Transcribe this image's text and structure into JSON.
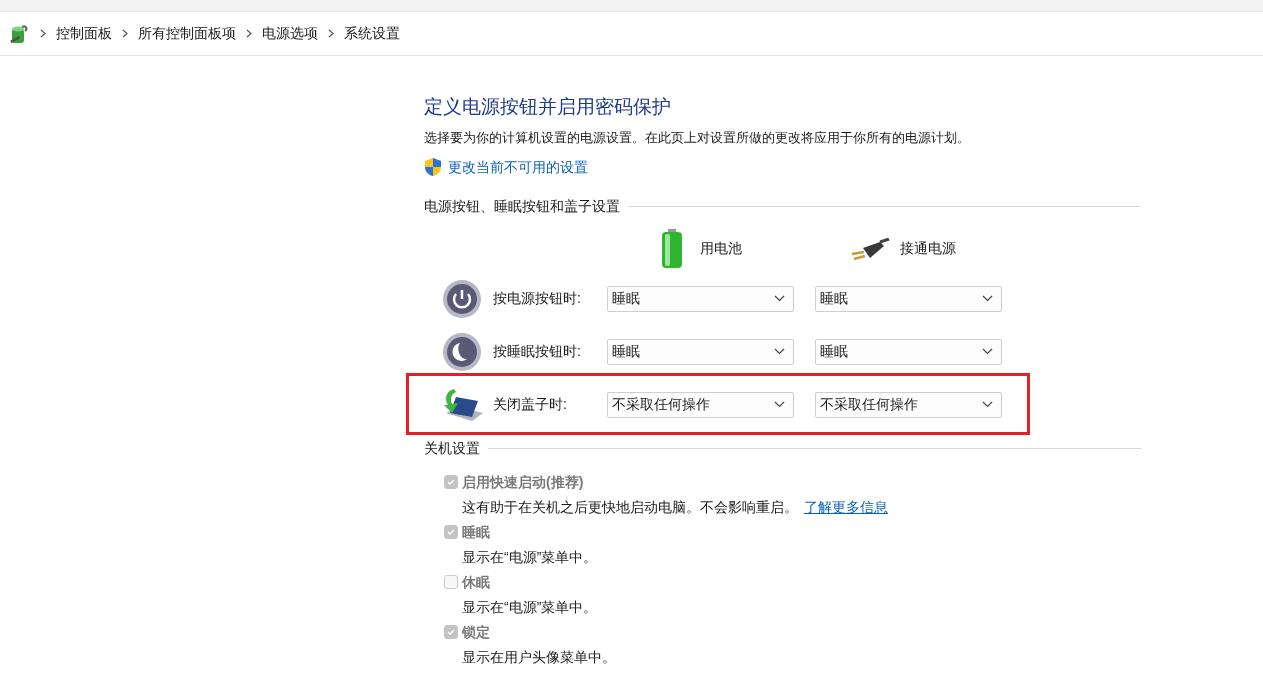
{
  "breadcrumb": [
    "控制面板",
    "所有控制面板项",
    "电源选项",
    "系统设置"
  ],
  "title": "定义电源按钮并启用密码保护",
  "description": "选择要为你的计算机设置的电源设置。在此页上对设置所做的更改将应用于你所有的电源计划。",
  "admin_link": "更改当前不可用的设置",
  "button_section": {
    "heading": "电源按钮、睡眠按钮和盖子设置",
    "columns": [
      {
        "kind": "battery",
        "label": "用电池"
      },
      {
        "kind": "plug",
        "label": "接通电源"
      }
    ],
    "rows": [
      {
        "kind": "power",
        "label": "按电源按钮时:",
        "values": [
          "睡眠",
          "睡眠"
        ],
        "highlighted": false
      },
      {
        "kind": "sleep",
        "label": "按睡眠按钮时:",
        "values": [
          "睡眠",
          "睡眠"
        ],
        "highlighted": false
      },
      {
        "kind": "lid",
        "label": "关闭盖子时:",
        "values": [
          "不采取任何操作",
          "不采取任何操作"
        ],
        "highlighted": true
      }
    ]
  },
  "shutdown_section": {
    "heading": "关机设置",
    "options": [
      {
        "label": "启用快速启动(推荐)",
        "checked": true,
        "disabled": true,
        "description": "这有助于在关机之后更快地启动电脑。不会影响重启。",
        "link": "了解更多信息"
      },
      {
        "label": "睡眠",
        "checked": true,
        "disabled": true,
        "description": "显示在“电源”菜单中。"
      },
      {
        "label": "休眠",
        "checked": false,
        "disabled": true,
        "description": "显示在“电源”菜单中。"
      },
      {
        "label": "锁定",
        "checked": true,
        "disabled": true,
        "description": "显示在用户头像菜单中。"
      }
    ]
  }
}
